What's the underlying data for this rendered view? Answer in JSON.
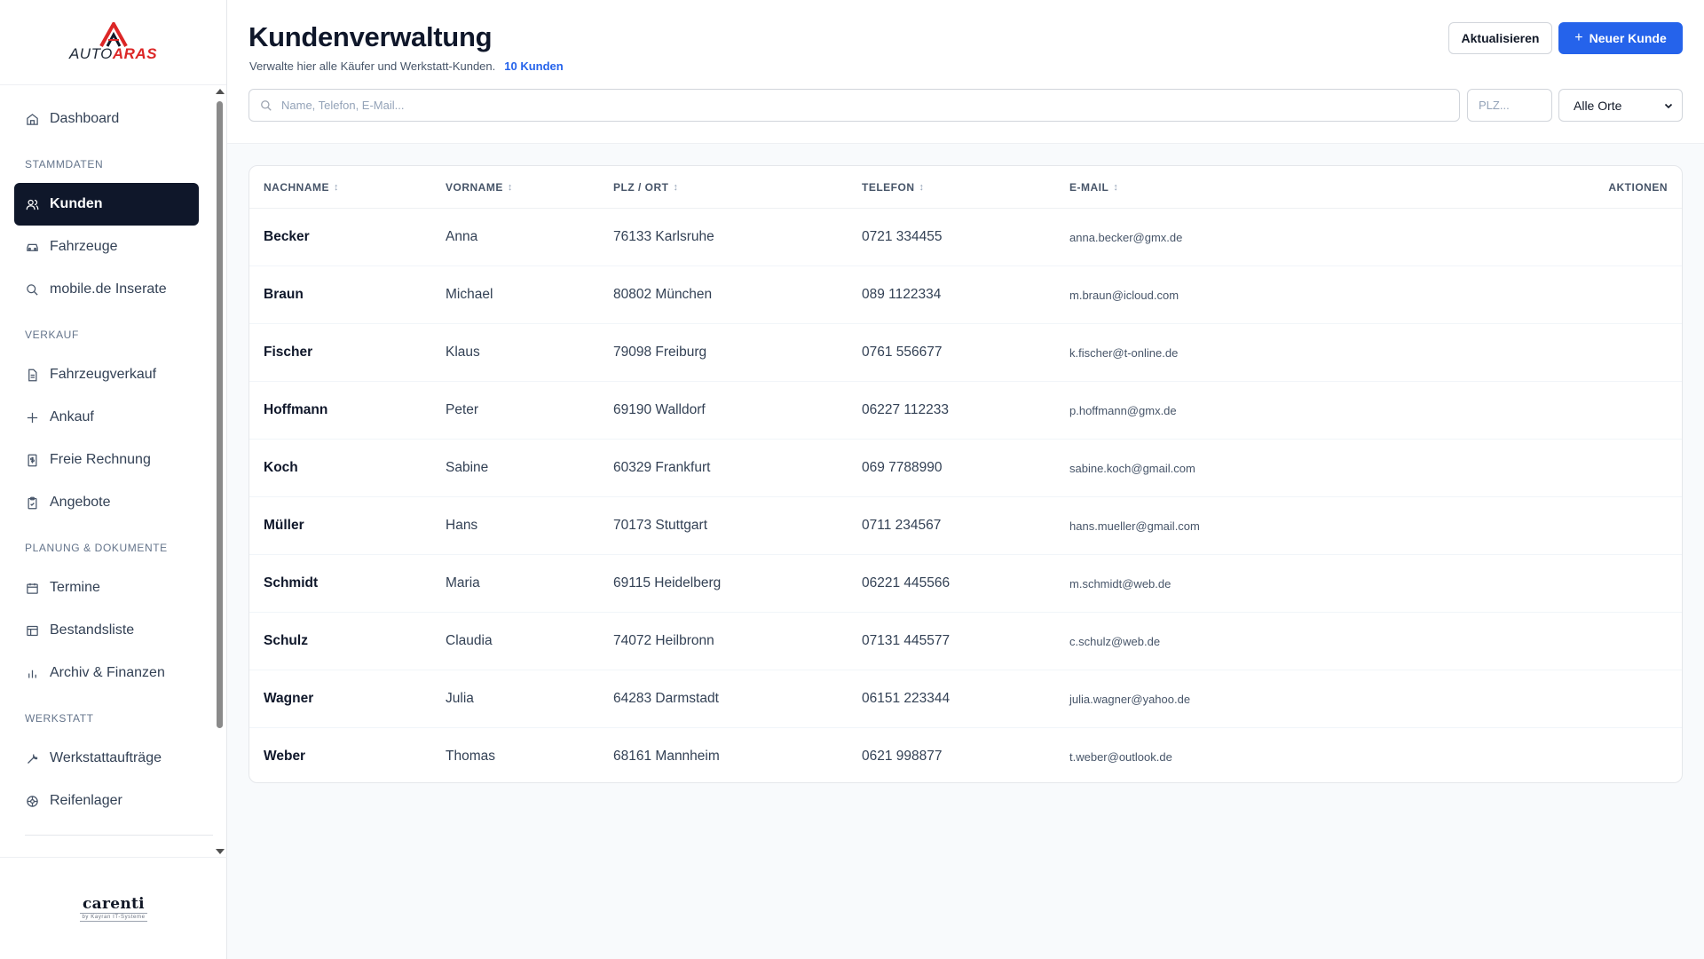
{
  "brand": {
    "logo_auto": "AUTO",
    "logo_aras": "ARAS",
    "footer_name": "carenti",
    "footer_sub": "by Kayran IT-Systeme"
  },
  "sidebar": {
    "dashboard": "Dashboard",
    "sections": {
      "stammdaten": "STAMMDATEN",
      "verkauf": "VERKAUF",
      "planung": "PLANUNG & DOKUMENTE",
      "werkstatt": "WERKSTATT"
    },
    "items": {
      "kunden": "Kunden",
      "fahrzeuge": "Fahrzeuge",
      "mobile": "mobile.de Inserate",
      "fahrzeugverkauf": "Fahrzeugverkauf",
      "ankauf": "Ankauf",
      "freie_rechnung": "Freie Rechnung",
      "angebote": "Angebote",
      "termine": "Termine",
      "bestandsliste": "Bestandsliste",
      "archiv": "Archiv & Finanzen",
      "werkstattauftraege": "Werkstattaufträge",
      "reifenlager": "Reifenlager"
    }
  },
  "header": {
    "title": "Kundenverwaltung",
    "subtitle": "Verwalte hier alle Käufer und Werkstatt-Kunden.",
    "count": "10 Kunden",
    "refresh_label": "Aktualisieren",
    "new_label": "Neuer Kunde",
    "new_plus": "+"
  },
  "filters": {
    "search_placeholder": "Name, Telefon, E-Mail...",
    "plz_placeholder": "PLZ...",
    "location_selected": "Alle Orte"
  },
  "table": {
    "columns": {
      "nachname": "NACHNAME",
      "vorname": "VORNAME",
      "plz_ort": "PLZ / ORT",
      "telefon": "TELEFON",
      "email": "E-MAIL",
      "aktionen": "AKTIONEN"
    },
    "rows": [
      {
        "nachname": "Becker",
        "vorname": "Anna",
        "plz_ort": "76133 Karlsruhe",
        "telefon": "0721 334455",
        "email": "anna.becker@gmx.de"
      },
      {
        "nachname": "Braun",
        "vorname": "Michael",
        "plz_ort": "80802 München",
        "telefon": "089 1122334",
        "email": "m.braun@icloud.com"
      },
      {
        "nachname": "Fischer",
        "vorname": "Klaus",
        "plz_ort": "79098 Freiburg",
        "telefon": "0761 556677",
        "email": "k.fischer@t-online.de"
      },
      {
        "nachname": "Hoffmann",
        "vorname": "Peter",
        "plz_ort": "69190 Walldorf",
        "telefon": "06227 112233",
        "email": "p.hoffmann@gmx.de"
      },
      {
        "nachname": "Koch",
        "vorname": "Sabine",
        "plz_ort": "60329 Frankfurt",
        "telefon": "069 7788990",
        "email": "sabine.koch@gmail.com"
      },
      {
        "nachname": "Müller",
        "vorname": "Hans",
        "plz_ort": "70173 Stuttgart",
        "telefon": "0711 234567",
        "email": "hans.mueller@gmail.com"
      },
      {
        "nachname": "Schmidt",
        "vorname": "Maria",
        "plz_ort": "69115 Heidelberg",
        "telefon": "06221 445566",
        "email": "m.schmidt@web.de"
      },
      {
        "nachname": "Schulz",
        "vorname": "Claudia",
        "plz_ort": "74072 Heilbronn",
        "telefon": "07131 445577",
        "email": "c.schulz@web.de"
      },
      {
        "nachname": "Wagner",
        "vorname": "Julia",
        "plz_ort": "64283 Darmstadt",
        "telefon": "06151 223344",
        "email": "julia.wagner@yahoo.de"
      },
      {
        "nachname": "Weber",
        "vorname": "Thomas",
        "plz_ort": "68161 Mannheim",
        "telefon": "0621 998877",
        "email": "t.weber@outlook.de"
      }
    ]
  },
  "colors": {
    "accent": "#2563eb",
    "active_nav": "#0f172a",
    "brand_red": "#dc2626"
  }
}
